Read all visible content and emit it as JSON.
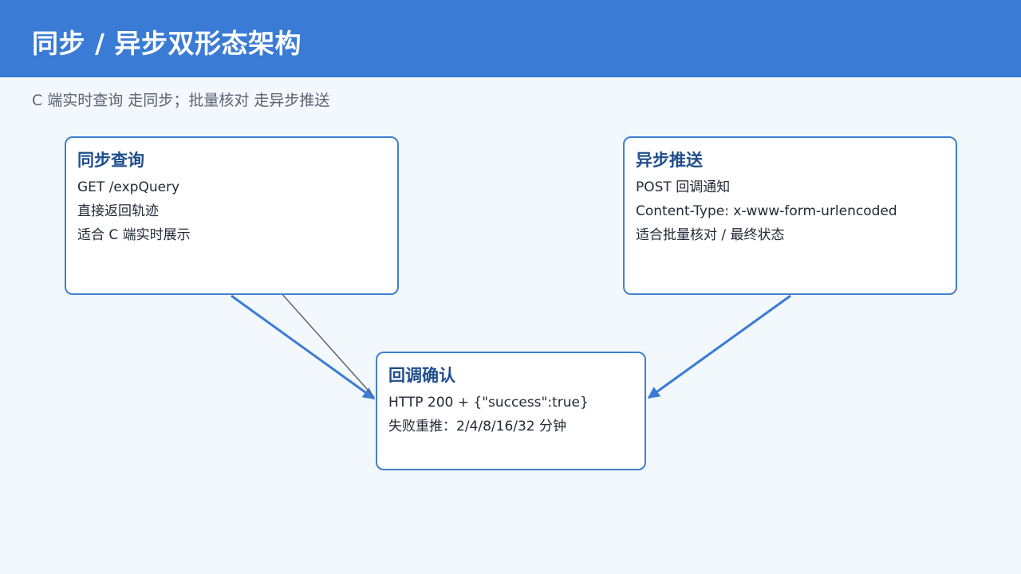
{
  "header": {
    "title": "同步 / 异步双形态架构"
  },
  "subtitle": "C 端实时查询 走同步；批量核对 走异步推送",
  "nodes": {
    "sync": {
      "title": "同步查询",
      "lines": [
        "GET /expQuery",
        "直接返回轨迹",
        "适合 C 端实时展示"
      ]
    },
    "async": {
      "title": "异步推送",
      "lines": [
        "POST 回调通知",
        "Content-Type: x-www-form-urlencoded",
        "适合批量核对 / 最终状态"
      ]
    },
    "callback": {
      "title": "回调确认",
      "lines": [
        "HTTP 200 + {\"success\":true}",
        "失败重推：2/4/8/16/32 分钟"
      ]
    }
  },
  "edges": [
    {
      "from": "sync",
      "to": "callback"
    },
    {
      "from": "async",
      "to": "callback"
    },
    {
      "from": "callback",
      "to": "sync"
    }
  ],
  "colors": {
    "header_bg": "#3a7bd5",
    "page_bg": "#f3f8fd",
    "box_border": "#3f7fd0",
    "box_title": "#1f4e8c",
    "edge_primary": "#3a7bd5",
    "edge_secondary": "#5a6578"
  }
}
